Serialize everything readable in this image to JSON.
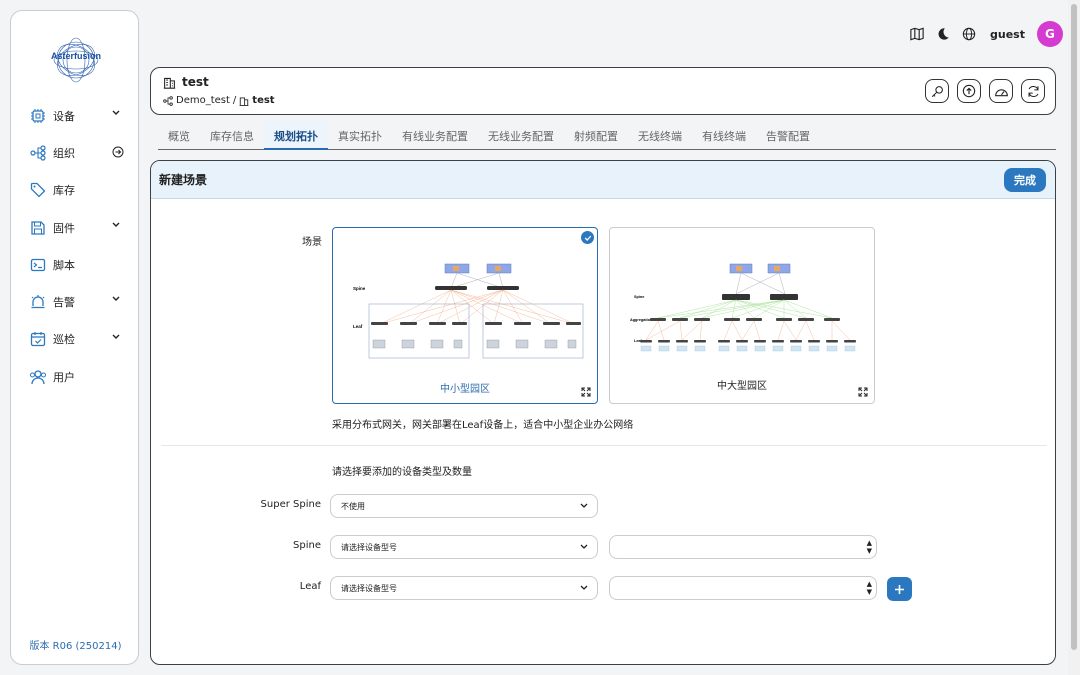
{
  "brand": {
    "logo_text": "Asterfusion"
  },
  "sidebar": {
    "items": [
      {
        "label": "设备",
        "icon": "chip-icon",
        "trail": "chevron"
      },
      {
        "label": "组织",
        "icon": "org-tree-icon",
        "trail": "arrow-circle"
      },
      {
        "label": "库存",
        "icon": "tag-icon",
        "trail": ""
      },
      {
        "label": "固件",
        "icon": "save-disk-icon",
        "trail": "chevron"
      },
      {
        "label": "脚本",
        "icon": "terminal-icon",
        "trail": ""
      },
      {
        "label": "告警",
        "icon": "alarm-bell-icon",
        "trail": "chevron"
      },
      {
        "label": "巡检",
        "icon": "calendar-check-icon",
        "trail": "chevron"
      },
      {
        "label": "用户",
        "icon": "users-icon",
        "trail": ""
      }
    ],
    "version": "版本 R06 (250214)"
  },
  "topbar": {
    "username": "guest",
    "avatar_letter": "G",
    "avatar_color": "#d63bd1"
  },
  "header": {
    "title": "test",
    "breadcrumb": {
      "parent": "Demo_test",
      "separator": "/",
      "current": "test"
    }
  },
  "tabs": [
    "概览",
    "库存信息",
    "规划拓扑",
    "真实拓扑",
    "有线业务配置",
    "无线业务配置",
    "射频配置",
    "无线终端",
    "有线终端",
    "告警配置"
  ],
  "active_tab": "规划拓扑",
  "main": {
    "title": "新建场景",
    "done_label": "完成",
    "scene_label": "场景",
    "scenes": [
      {
        "caption": "中小型园区",
        "selected": true,
        "diagram_labels": [
          "Spine",
          "Leaf"
        ]
      },
      {
        "caption": "中大型园区",
        "selected": false,
        "diagram_labels": [
          "Spine",
          "Aggregation",
          "Leaf"
        ]
      }
    ],
    "scene_description": "采用分布式网关，网关部署在Leaf设备上，适合中小型企业办公网络",
    "device_prompt": "请选择要添加的设备类型及数量",
    "rows": [
      {
        "label": "Super Spine",
        "select_value": "不使用",
        "has_number": false,
        "has_add": false
      },
      {
        "label": "Spine",
        "select_value": "请选择设备型号",
        "has_number": true,
        "has_add": false
      },
      {
        "label": "Leaf",
        "select_value": "请选择设备型号",
        "has_number": true,
        "has_add": true
      }
    ]
  },
  "colors": {
    "accent": "#2b78c0",
    "header_bg": "#e8f2fb"
  }
}
